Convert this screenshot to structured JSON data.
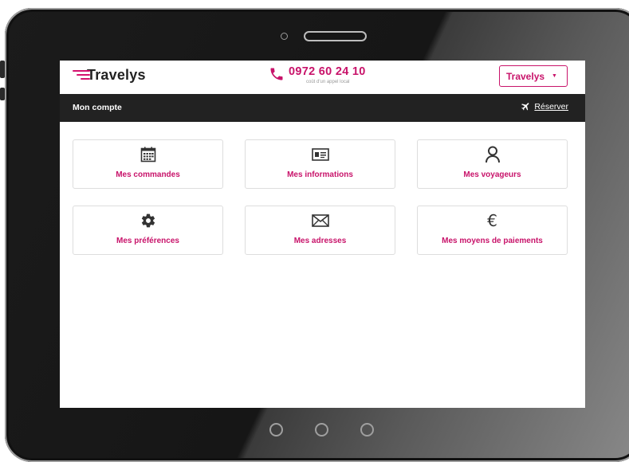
{
  "header": {
    "logo_text": "Travelys",
    "phone_number": "0972 60 24 10",
    "phone_note": "coût d'un appel local",
    "brand_select": "Travelys"
  },
  "navbar": {
    "title": "Mon compte",
    "reserve_label": "Réserver"
  },
  "menu": {
    "items": [
      {
        "label": "Mes commandes",
        "icon": "calendar-icon"
      },
      {
        "label": "Mes informations",
        "icon": "id-card-icon"
      },
      {
        "label": "Mes voyageurs",
        "icon": "user-icon"
      },
      {
        "label": "Mes préférences",
        "icon": "gear-icon"
      },
      {
        "label": "Mes adresses",
        "icon": "envelope-icon"
      },
      {
        "label": "Mes moyens de paiements",
        "icon": "euro-icon"
      }
    ]
  },
  "colors": {
    "accent": "#c8136a",
    "navbar": "#222222",
    "card_border": "#dddddd"
  }
}
